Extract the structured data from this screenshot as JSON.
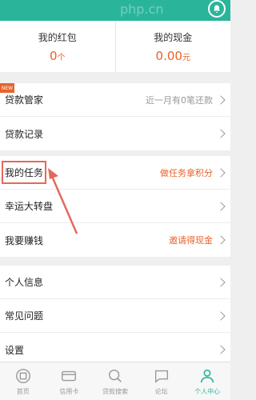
{
  "watermark": "php.cn",
  "stats": [
    {
      "title": "我的红包",
      "value": "0",
      "unit": "个"
    },
    {
      "title": "我的现金",
      "value": "0.00",
      "unit": "元"
    }
  ],
  "group1": {
    "corner_tag": "NEW",
    "rows": [
      {
        "label": "贷款管家",
        "right": "近一月有0笔还款"
      },
      {
        "label": "贷款记录",
        "right": ""
      }
    ]
  },
  "group2": {
    "rows": [
      {
        "label": "我的任务",
        "right": "做任务拿积分"
      },
      {
        "label": "幸运大转盘",
        "right": ""
      },
      {
        "label": "我要赚钱",
        "right": "邀请得现金"
      }
    ]
  },
  "group3": {
    "rows": [
      {
        "label": "个人信息",
        "right": ""
      },
      {
        "label": "常见问题",
        "right": ""
      },
      {
        "label": "设置",
        "right": ""
      }
    ]
  },
  "tabs": [
    {
      "label": "首页",
      "icon": "home-icon"
    },
    {
      "label": "信用卡",
      "icon": "credit-card-icon"
    },
    {
      "label": "贷款搜索",
      "icon": "search-icon"
    },
    {
      "label": "论坛",
      "icon": "forum-icon"
    },
    {
      "label": "个人中心",
      "icon": "person-icon"
    }
  ],
  "colors": {
    "accent": "#2ab59b",
    "orange": "#e8622a",
    "highlight": "#e36a5a"
  }
}
